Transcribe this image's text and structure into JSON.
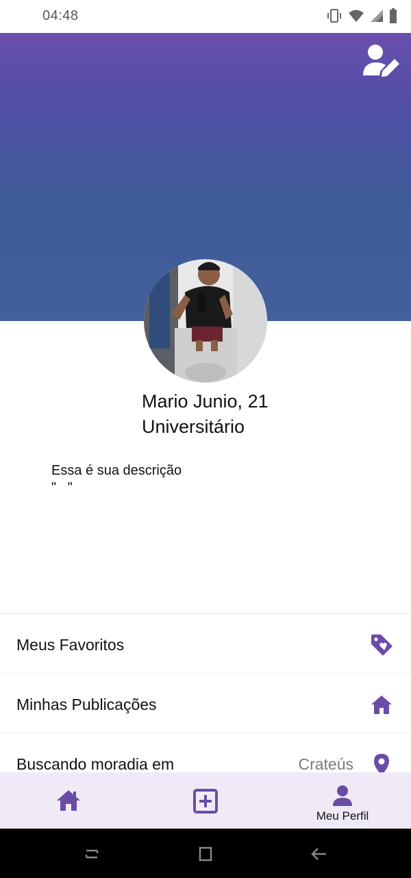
{
  "status_bar": {
    "time": "04:48",
    "icons": [
      "vibrate-icon",
      "wifi-icon",
      "signal-icon",
      "battery-icon"
    ]
  },
  "header": {
    "gradient_colors": [
      "#6b4fae",
      "#3f5a98"
    ],
    "edit_icon": "user-edit-icon"
  },
  "profile": {
    "name_age": "Mario Junio, 21",
    "occupation": "Universitário",
    "description_label": "Essa é sua descrição",
    "description": "\"   \""
  },
  "menu": {
    "items": [
      {
        "label": "Meus Favoritos",
        "icon": "tag-heart-icon"
      },
      {
        "label": "Minhas Publicações",
        "icon": "home-icon"
      },
      {
        "label": "Buscando moradia em",
        "value": "Crateús",
        "icon": "map-pin-icon"
      }
    ]
  },
  "bottom_nav": {
    "items": [
      {
        "icon": "home-icon",
        "label": ""
      },
      {
        "icon": "plus-square-icon",
        "label": ""
      },
      {
        "icon": "user-icon",
        "label": "Meu Perfil"
      }
    ],
    "active_index": 2
  },
  "colors": {
    "accent": "#6a4ca8",
    "nav_bg": "#efeaf6"
  }
}
